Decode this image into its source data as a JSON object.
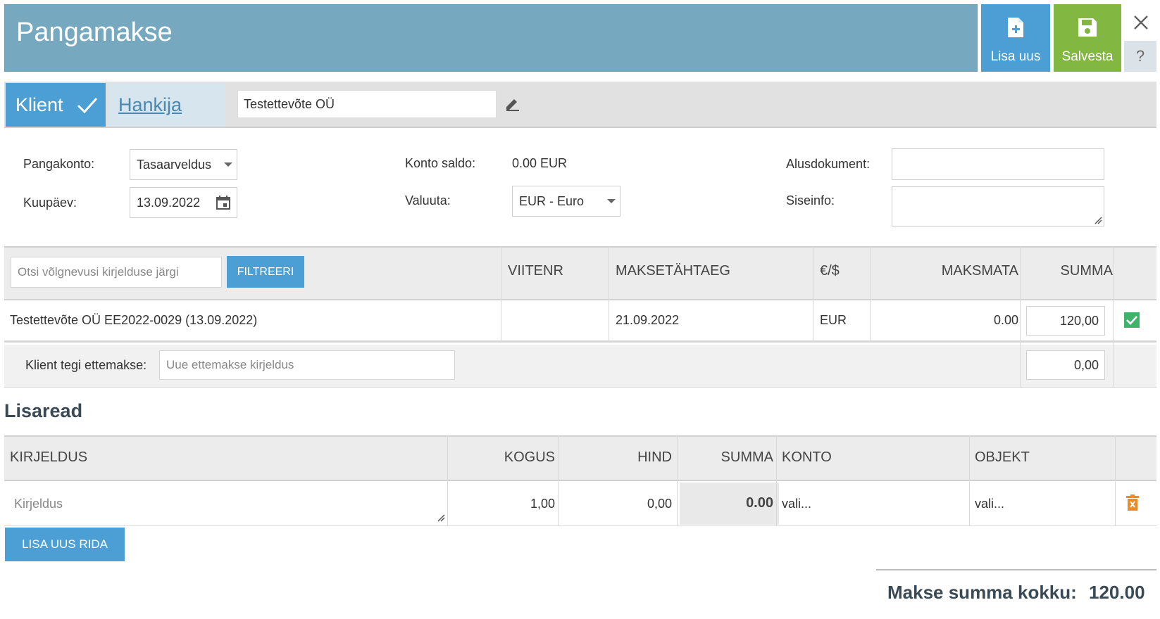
{
  "header": {
    "title": "Pangamakse",
    "new_label": "Lisa uus",
    "save_label": "Salvesta",
    "help_label": "?",
    "colors": {
      "bar": "#76a9bf",
      "new": "#4b9fd5",
      "save": "#82b741"
    }
  },
  "party": {
    "tab_client": "Klient",
    "tab_supplier": "Hankija",
    "name_value": "Testettevõte OÜ"
  },
  "form": {
    "bank_account_label": "Pangakonto:",
    "bank_account_value": "Tasaarveldus",
    "date_label": "Kuupäev:",
    "date_value": "13.09.2022",
    "balance_label": "Konto saldo:",
    "balance_value": "0.00 EUR",
    "currency_label": "Valuuta:",
    "currency_value": "EUR - Euro",
    "base_doc_label": "Alusdokument:",
    "base_doc_value": "",
    "internal_info_label": "Siseinfo:",
    "internal_info_value": ""
  },
  "debts": {
    "search_placeholder": "Otsi võlgnevusi kirjelduse järgi",
    "filter_label": "FILTREERI",
    "columns": {
      "ref": "VIITENR",
      "due": "MAKSETÄHTAEG",
      "currency": "€/$",
      "unpaid": "MAKSMATA",
      "sum": "SUMMA"
    },
    "rows": [
      {
        "description": "Testettevõte OÜ EE2022-0029 (13.09.2022)",
        "ref": "",
        "due": "21.09.2022",
        "currency": "EUR",
        "unpaid": "0.00",
        "sum": "120,00",
        "checked": true
      }
    ],
    "prepayment_label": "Klient tegi ettemakse:",
    "prepayment_placeholder": "Uue ettemakse kirjeldus",
    "prepayment_sum": "0,00"
  },
  "extra": {
    "title": "Lisaread",
    "columns": {
      "description": "KIRJELDUS",
      "qty": "KOGUS",
      "price": "HIND",
      "sum": "SUMMA",
      "account": "KONTO",
      "object": "OBJEKT"
    },
    "rows": [
      {
        "description_placeholder": "Kirjeldus",
        "qty": "1,00",
        "price": "0,00",
        "sum": "0.00",
        "account": "vali...",
        "object": "vali..."
      }
    ],
    "add_row_label": "LISA UUS RIDA"
  },
  "totals": {
    "label": "Makse summa kokku:",
    "value": "120.00"
  }
}
